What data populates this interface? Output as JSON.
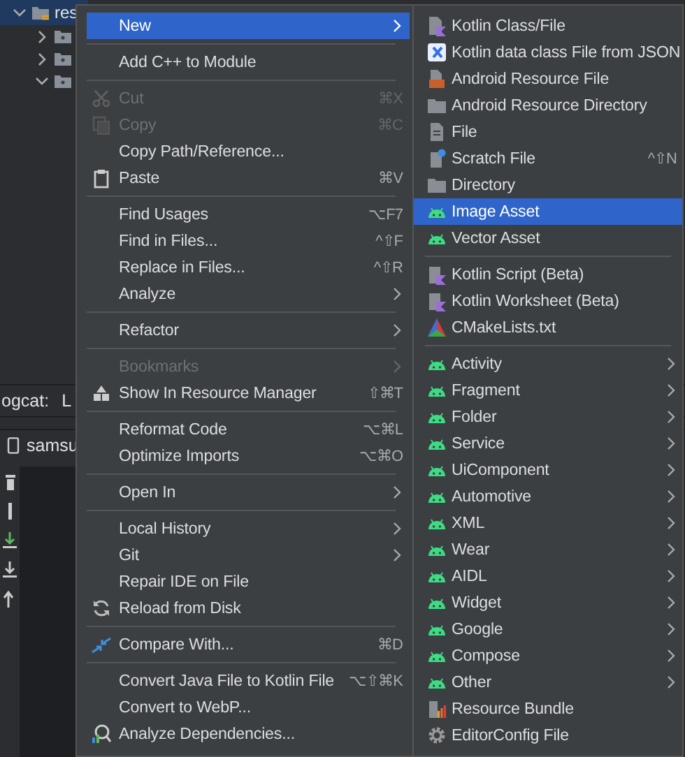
{
  "project_tree": {
    "items": [
      {
        "label": "res",
        "expanded": true,
        "selected": true
      },
      {
        "expanded": false,
        "selected": false
      },
      {
        "expanded": false,
        "selected": false
      },
      {
        "expanded": true,
        "selected": false
      }
    ]
  },
  "logcat_bar": {
    "label": "ogcat:",
    "filter": "L"
  },
  "device_tab": {
    "label": "samsu"
  },
  "context_menu": {
    "groups": [
      {
        "items": [
          {
            "label": "New",
            "submenu": true,
            "disabled": false,
            "selected": true
          }
        ]
      },
      {
        "items": [
          {
            "label": "Add C++ to Module",
            "submenu": false,
            "disabled": false,
            "selected": false
          }
        ]
      },
      {
        "items": [
          {
            "label": "Cut",
            "shortcut": "⌘X",
            "submenu": false,
            "disabled": true,
            "selected": false
          },
          {
            "label": "Copy",
            "shortcut": "⌘C",
            "submenu": false,
            "disabled": true,
            "selected": false
          },
          {
            "label": "Copy Path/Reference...",
            "submenu": false,
            "disabled": false,
            "selected": false
          },
          {
            "label": "Paste",
            "shortcut": "⌘V",
            "submenu": false,
            "disabled": false,
            "selected": false
          }
        ]
      },
      {
        "items": [
          {
            "label": "Find Usages",
            "shortcut": "⌥F7",
            "submenu": false,
            "disabled": false,
            "selected": false
          },
          {
            "label": "Find in Files...",
            "shortcut": "^⇧F",
            "submenu": false,
            "disabled": false,
            "selected": false
          },
          {
            "label": "Replace in Files...",
            "shortcut": "^⇧R",
            "submenu": false,
            "disabled": false,
            "selected": false
          },
          {
            "label": "Analyze",
            "submenu": true,
            "disabled": false,
            "selected": false
          }
        ]
      },
      {
        "items": [
          {
            "label": "Refactor",
            "submenu": true,
            "disabled": false,
            "selected": false
          }
        ]
      },
      {
        "items": [
          {
            "label": "Bookmarks",
            "submenu": true,
            "disabled": true,
            "selected": false
          },
          {
            "label": "Show In Resource Manager",
            "shortcut": "⇧⌘T",
            "submenu": false,
            "disabled": false,
            "selected": false
          }
        ]
      },
      {
        "items": [
          {
            "label": "Reformat Code",
            "shortcut": "⌥⌘L",
            "submenu": false,
            "disabled": false,
            "selected": false
          },
          {
            "label": "Optimize Imports",
            "shortcut": "⌥⌘O",
            "submenu": false,
            "disabled": false,
            "selected": false
          }
        ]
      },
      {
        "items": [
          {
            "label": "Open In",
            "submenu": true,
            "disabled": false,
            "selected": false
          }
        ]
      },
      {
        "items": [
          {
            "label": "Local History",
            "submenu": true,
            "disabled": false,
            "selected": false
          },
          {
            "label": "Git",
            "submenu": true,
            "disabled": false,
            "selected": false
          },
          {
            "label": "Repair IDE on File",
            "submenu": false,
            "disabled": false,
            "selected": false
          },
          {
            "label": "Reload from Disk",
            "submenu": false,
            "disabled": false,
            "selected": false
          }
        ]
      },
      {
        "items": [
          {
            "label": "Compare With...",
            "shortcut": "⌘D",
            "submenu": false,
            "disabled": false,
            "selected": false
          }
        ]
      },
      {
        "items": [
          {
            "label": "Convert Java File to Kotlin File",
            "shortcut": "⌥⇧⌘K",
            "submenu": false,
            "disabled": false,
            "selected": false
          },
          {
            "label": "Convert to WebP...",
            "submenu": false,
            "disabled": false,
            "selected": false
          },
          {
            "label": "Analyze Dependencies...",
            "submenu": false,
            "disabled": false,
            "selected": false
          }
        ]
      }
    ]
  },
  "new_submenu": {
    "groups": [
      {
        "items": [
          {
            "label": "Kotlin Class/File",
            "submenu": false,
            "disabled": false,
            "selected": false
          },
          {
            "label": "Kotlin data class File from JSON",
            "submenu": false,
            "disabled": false,
            "selected": false
          },
          {
            "label": "Android Resource File",
            "submenu": false,
            "disabled": false,
            "selected": false
          },
          {
            "label": "Android Resource Directory",
            "submenu": false,
            "disabled": false,
            "selected": false
          },
          {
            "label": "File",
            "submenu": false,
            "disabled": false,
            "selected": false
          },
          {
            "label": "Scratch File",
            "shortcut": "^⇧N",
            "submenu": false,
            "disabled": false,
            "selected": false
          },
          {
            "label": "Directory",
            "submenu": false,
            "disabled": false,
            "selected": false
          },
          {
            "label": "Image Asset",
            "submenu": false,
            "disabled": false,
            "selected": true
          },
          {
            "label": "Vector Asset",
            "submenu": false,
            "disabled": false,
            "selected": false
          }
        ]
      },
      {
        "items": [
          {
            "label": "Kotlin Script (Beta)",
            "submenu": false,
            "disabled": false,
            "selected": false
          },
          {
            "label": "Kotlin Worksheet (Beta)",
            "submenu": false,
            "disabled": false,
            "selected": false
          },
          {
            "label": "CMakeLists.txt",
            "submenu": false,
            "disabled": false,
            "selected": false
          }
        ]
      },
      {
        "items": [
          {
            "label": "Activity",
            "submenu": true,
            "disabled": false,
            "selected": false
          },
          {
            "label": "Fragment",
            "submenu": true,
            "disabled": false,
            "selected": false
          },
          {
            "label": "Folder",
            "submenu": true,
            "disabled": false,
            "selected": false
          },
          {
            "label": "Service",
            "submenu": true,
            "disabled": false,
            "selected": false
          },
          {
            "label": "UiComponent",
            "submenu": true,
            "disabled": false,
            "selected": false
          },
          {
            "label": "Automotive",
            "submenu": true,
            "disabled": false,
            "selected": false
          },
          {
            "label": "XML",
            "submenu": true,
            "disabled": false,
            "selected": false
          },
          {
            "label": "Wear",
            "submenu": true,
            "disabled": false,
            "selected": false
          },
          {
            "label": "AIDL",
            "submenu": true,
            "disabled": false,
            "selected": false
          },
          {
            "label": "Widget",
            "submenu": true,
            "disabled": false,
            "selected": false
          },
          {
            "label": "Google",
            "submenu": true,
            "disabled": false,
            "selected": false
          },
          {
            "label": "Compose",
            "submenu": true,
            "disabled": false,
            "selected": false
          },
          {
            "label": "Other",
            "submenu": true,
            "disabled": false,
            "selected": false
          },
          {
            "label": "Resource Bundle",
            "submenu": false,
            "disabled": false,
            "selected": false
          },
          {
            "label": "EditorConfig File",
            "submenu": false,
            "disabled": false,
            "selected": false
          }
        ]
      }
    ]
  }
}
